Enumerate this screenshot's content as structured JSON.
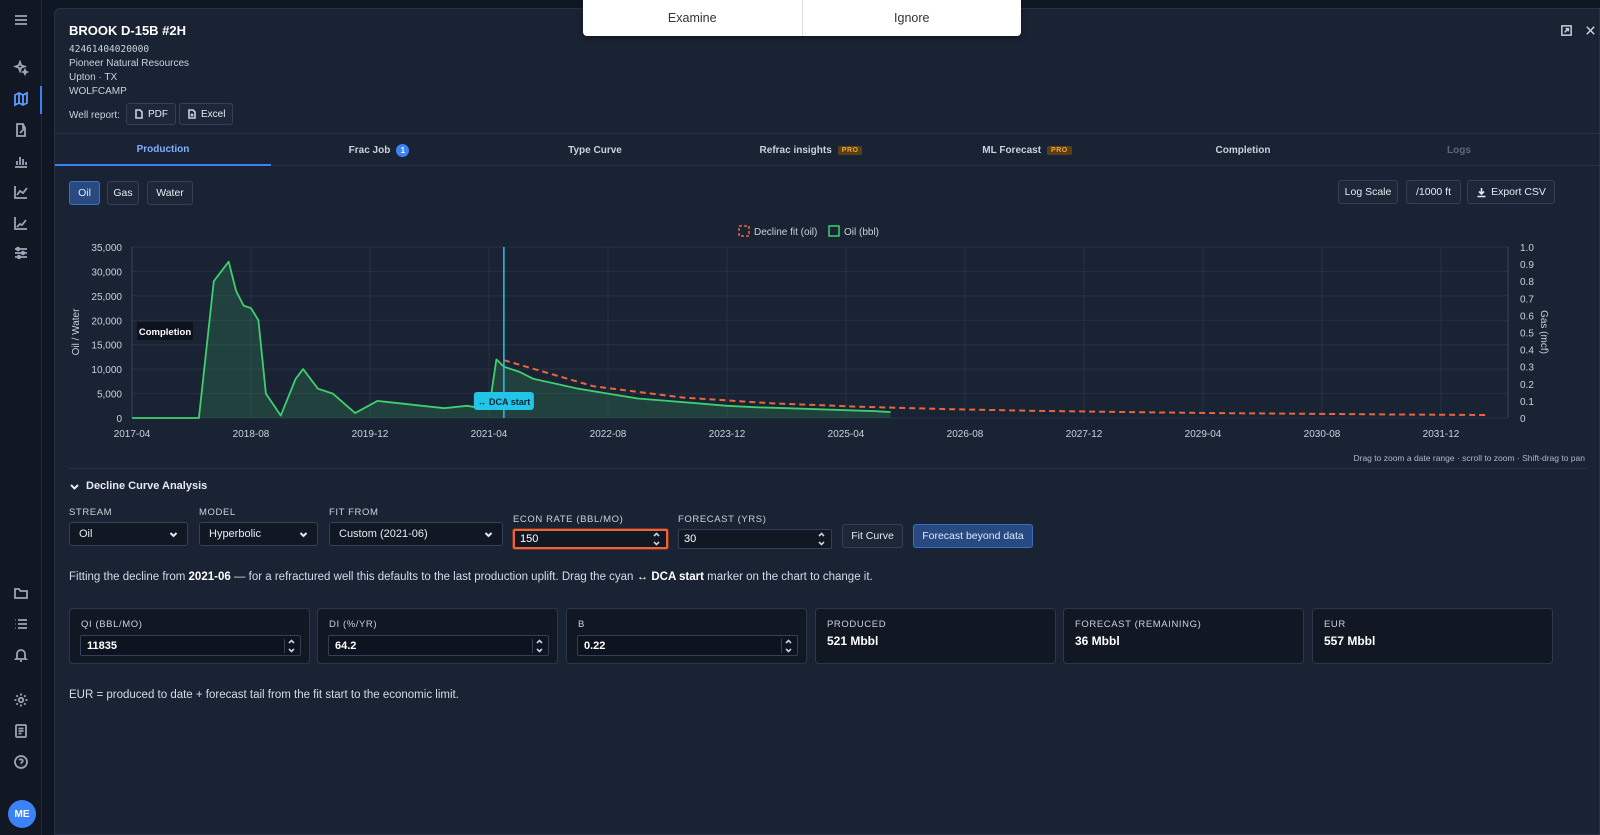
{
  "sidebar": {
    "avatar_initials": "ME"
  },
  "popup": {
    "examine_label": "Examine",
    "ignore_label": "Ignore"
  },
  "well": {
    "name": "BROOK D-15B #2H",
    "api": "42461404020000",
    "operator": "Pioneer Natural Resources",
    "location": "Upton · TX",
    "formation": "WOLFCAMP",
    "report_label": "Well report:",
    "pdf_label": "PDF",
    "excel_label": "Excel"
  },
  "tabs": {
    "production": "Production",
    "frac_job": "Frac Job",
    "frac_job_count": "1",
    "type_curve": "Type Curve",
    "refrac": "Refrac insights",
    "ml_forecast": "ML Forecast",
    "pro_badge": "PRO",
    "completion": "Completion",
    "logs": "Logs"
  },
  "streams": {
    "oil": "Oil",
    "gas": "Gas",
    "water": "Water"
  },
  "tools": {
    "log_scale": "Log Scale",
    "per_1000": "/1000 ft",
    "export_csv": "Export CSV"
  },
  "chart_data": {
    "type": "line",
    "legend": [
      "Decline fit (oil)",
      "Oil (bbl)"
    ],
    "legend_position": "top-center",
    "ylabel": "Oil / Water",
    "y2label": "Gas (mcf)",
    "ylim": [
      0,
      35000
    ],
    "y_ticks": [
      "35,000",
      "30,000",
      "25,000",
      "20,000",
      "15,000",
      "10,000",
      "5,000",
      "0"
    ],
    "y2lim": [
      0,
      1
    ],
    "y2_ticks": [
      "1.0",
      "0.9",
      "0.8",
      "0.7",
      "0.6",
      "0.5",
      "0.4",
      "0.3",
      "0.2",
      "0.1",
      "0"
    ],
    "x_ticks": [
      "2017-04",
      "2018-08",
      "2019-12",
      "2021-04",
      "2022-08",
      "2023-12",
      "2025-04",
      "2026-08",
      "2027-12",
      "2029-04",
      "2030-08",
      "2031-12"
    ],
    "grid": true,
    "colors": {
      "oil": "#3ecf6e",
      "decline": "#e8663d",
      "dca_marker": "#22c4e8"
    },
    "annotations": {
      "completion": "Completion",
      "dca_start": "↔ DCA start"
    },
    "dca_start_date": "2021-06",
    "series": [
      {
        "name": "Oil (bbl)",
        "x": [
          "2017-04",
          "2018-01",
          "2018-03",
          "2018-05",
          "2018-06",
          "2018-07",
          "2018-08",
          "2018-09",
          "2018-10",
          "2018-12",
          "2019-02",
          "2019-03",
          "2019-05",
          "2019-07",
          "2019-10",
          "2020-01",
          "2020-04",
          "2020-07",
          "2020-10",
          "2021-01",
          "2021-04",
          "2021-05",
          "2021-06",
          "2021-08",
          "2021-10",
          "2022-01",
          "2022-04",
          "2022-08",
          "2022-12",
          "2023-04",
          "2023-08",
          "2023-12",
          "2024-04",
          "2024-08",
          "2024-12",
          "2025-04",
          "2025-08",
          "2025-10"
        ],
        "y": [
          0,
          0,
          28000,
          32000,
          26000,
          23000,
          22500,
          20000,
          5000,
          500,
          8000,
          10000,
          6000,
          5000,
          1000,
          3500,
          3000,
          2500,
          2000,
          2500,
          1800,
          12000,
          10500,
          9500,
          8000,
          7000,
          6000,
          5000,
          4000,
          3500,
          3000,
          2500,
          2200,
          2000,
          1800,
          1600,
          1400,
          1200
        ]
      },
      {
        "name": "Decline fit (oil)",
        "x": [
          "2021-06",
          "2022-06",
          "2023-06",
          "2024-06",
          "2025-06",
          "2026-06",
          "2027-06",
          "2028-06",
          "2029-06",
          "2030-06",
          "2031-06",
          "2032-06"
        ],
        "y": [
          11835,
          6500,
          4200,
          3000,
          2300,
          1800,
          1450,
          1200,
          1000,
          850,
          720,
          620
        ]
      }
    ]
  },
  "hint": "Drag to zoom a date range · scroll to zoom · Shift-drag to pan",
  "dca": {
    "title": "Decline Curve Analysis",
    "stream_label": "STREAM",
    "stream_value": "Oil",
    "model_label": "MODEL",
    "model_value": "Hyperbolic",
    "fit_from_label": "FIT FROM",
    "fit_from_value": "Custom (2021-06)",
    "econ_rate_label": "ECON RATE (BBL/MO)",
    "econ_rate_value": "150",
    "forecast_label": "FORECAST (YRS)",
    "forecast_value": "30",
    "fit_curve_label": "Fit Curve",
    "forecast_beyond_label": "Forecast beyond data",
    "desc_prefix": "Fitting the decline from ",
    "desc_date": "2021-06",
    "desc_mid": " — for a refractured well this defaults to the last production uplift. Drag the cyan ",
    "desc_marker": "↔ DCA start",
    "desc_suffix": " marker on the chart to change it."
  },
  "cards": {
    "qi_label": "QI (BBL/MO)",
    "qi_value": "11835",
    "di_label": "DI (%/YR)",
    "di_value": "64.2",
    "b_label": "B",
    "b_value": "0.22",
    "produced_label": "PRODUCED",
    "produced_value": "521 Mbbl",
    "forecast_label": "FORECAST (REMAINING)",
    "forecast_value": "36 Mbbl",
    "eur_label": "EUR",
    "eur_value": "557 Mbbl"
  },
  "footnote": "EUR = produced to date + forecast tail from the fit start to the economic limit."
}
